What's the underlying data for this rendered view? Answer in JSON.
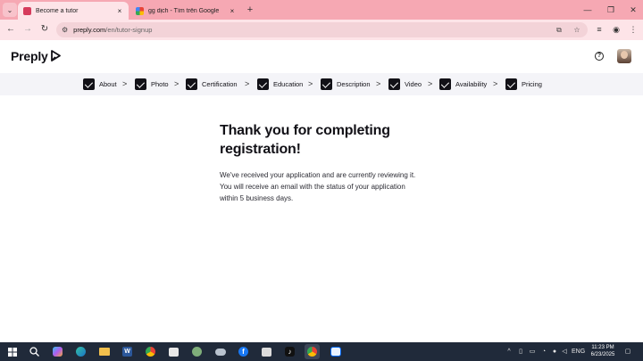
{
  "browser": {
    "tabs": [
      {
        "title": "Become a tutor",
        "active": true
      },
      {
        "title": "gg dịch - Tìm trên Google",
        "active": false
      }
    ],
    "tab_close_glyph": "×",
    "new_tab_glyph": "+",
    "window_controls": [
      "—",
      "❐",
      "✕"
    ],
    "address": {
      "host": "preply.com",
      "path": "/en/tutor-signup"
    }
  },
  "site": {
    "logo_text": "Preply",
    "steps": [
      {
        "label": "About",
        "completed": true
      },
      {
        "label": "Photo",
        "completed": true
      },
      {
        "label": "Certification",
        "completed": true
      },
      {
        "label": "Education",
        "completed": true
      },
      {
        "label": "Description",
        "completed": true
      },
      {
        "label": "Video",
        "completed": true
      },
      {
        "label": "Availability",
        "completed": true
      },
      {
        "label": "Pricing",
        "completed": true
      }
    ],
    "step_separator": ">"
  },
  "main": {
    "title": "Thank you for completing registration!",
    "message": "We've received your application and are currently reviewing it. You will receive an email with the status of your application within 5 business days."
  },
  "taskbar": {
    "language": "ENG",
    "time": "11:23 PM",
    "date": "6/23/2025"
  },
  "colors": {
    "tabstrip": "#f6a8b3",
    "toolbar": "#fde4e8",
    "steps_bg": "#f4f4f8",
    "check": "#121117",
    "taskbar": "#202a3a"
  }
}
